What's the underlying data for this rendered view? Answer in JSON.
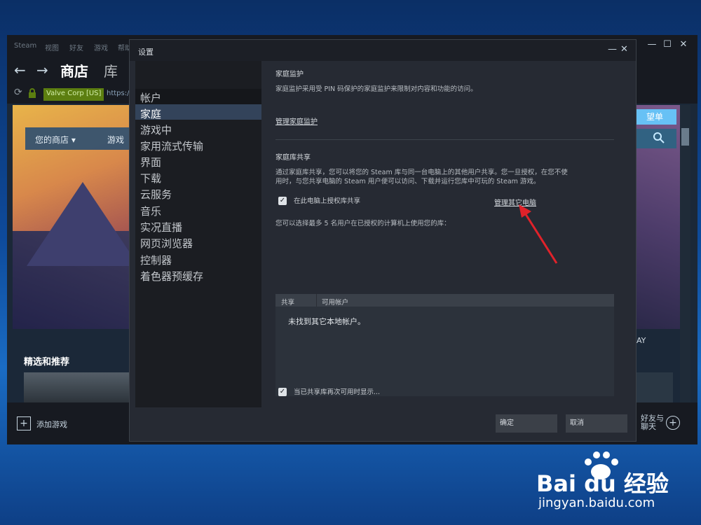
{
  "steam": {
    "menu": [
      "Steam",
      "视图",
      "好友",
      "游戏",
      "帮助"
    ],
    "window_controls": [
      "—",
      "☐",
      "✕"
    ],
    "nav": {
      "back": "←",
      "forward": "→",
      "store": "商店",
      "library": "库"
    },
    "url_bar": {
      "refresh": "⟳",
      "lock": "🔒",
      "badge": "Valve Corp [US]",
      "url": "https://"
    },
    "store": {
      "tab_your_store": "您的商店 ▾",
      "tab_games": "游戏",
      "wishlist": "望单",
      "featured_title": "精选和推荐",
      "day_text": "AY"
    },
    "bottom": {
      "add_game": "添加游戏",
      "add_game_icon": "+",
      "friends": "好友与聊天",
      "friends_icon": "+"
    }
  },
  "settings": {
    "title": "设置",
    "controls": [
      "—",
      "✕"
    ],
    "sidebar": [
      "帐户",
      "家庭",
      "游戏中",
      "家用流式传输",
      "界面",
      "下载",
      "云服务",
      "音乐",
      "实况直播",
      "网页浏览器",
      "控制器",
      "着色器预缓存"
    ],
    "selected_index": 1,
    "family_view": {
      "title": "家庭监护",
      "description": "家庭监护采用受 PIN 码保护的家庭监护来限制对内容和功能的访问。",
      "manage_link": "管理家庭监护"
    },
    "library_sharing": {
      "title": "家庭库共享",
      "description_line1": "通过家庭库共享，您可以将您的 Steam 库与同一台电脑上的其他用户共享。您一旦授权，在您不使",
      "description_line2": "用时，与您共享电脑的 Steam 用户便可以访问、下载并运行您库中可玩的 Steam 游戏。",
      "authorize_checkbox_label": "在此电脑上授权库共享",
      "authorize_checked": true,
      "manage_other_computers": "管理其它电脑",
      "select_users_text": "您可以选择最多 5 名用户在已授权的计算机上使用您的库：",
      "table": {
        "col_share": "共享",
        "col_accounts": "可用帐户",
        "empty_message": "未找到其它本地帐户。"
      },
      "notify_checkbox_label": "当已共享库再次可用时显示...",
      "notify_checked": true
    },
    "buttons": {
      "ok": "确定",
      "cancel": "取消"
    }
  },
  "watermark": {
    "logo_text": "Bai du 经验",
    "url": "jingyan.baidu.com"
  },
  "colors": {
    "accent": "#67c1f5",
    "arrow": "#e0222a",
    "badge": "#5c7e10"
  }
}
